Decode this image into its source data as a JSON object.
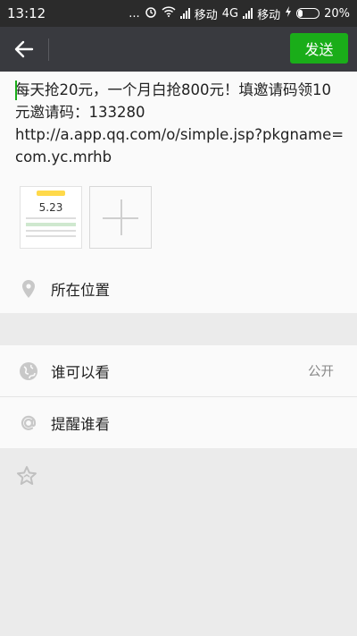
{
  "status_bar": {
    "time": "13:12",
    "dots": "...",
    "carrier1": "移动",
    "network": "4G",
    "carrier2": "移动",
    "battery_percent": "20%"
  },
  "title_bar": {
    "send_label": "发送"
  },
  "compose": {
    "text": "每天抢20元，一个月白抢800元！填邀请码领10元邀请码：133280\nhttp://a.app.qq.com/o/simple.jsp?pkgname=com.yc.mrhb"
  },
  "thumbnail": {
    "amount": "5.23"
  },
  "location": {
    "label": "所在位置"
  },
  "rows": [
    {
      "label": "谁可以看",
      "value": "公开",
      "icon": "globe-icon"
    },
    {
      "label": "提醒谁看",
      "value": "",
      "icon": "at-icon"
    }
  ],
  "colors": {
    "accent_green": "#1aad19",
    "title_bar": "#393a3f",
    "status_bar": "#2b2b2b"
  }
}
